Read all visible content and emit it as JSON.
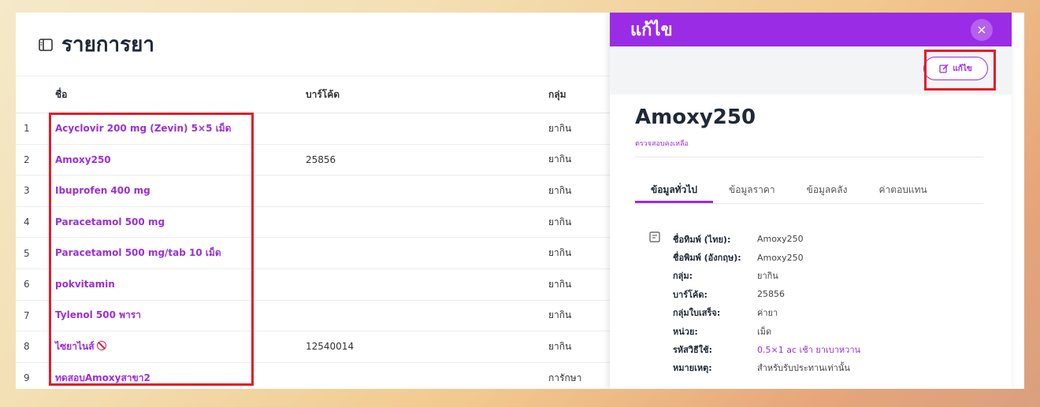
{
  "list": {
    "title": "รายการยา",
    "columns": {
      "name": "ชื่อ",
      "barcode": "บาร์โค้ด",
      "group": "กลุ่ม"
    },
    "rows": [
      {
        "no": "1",
        "name": "Acyclovir 200 mg (Zevin) 5×5 เม็ด",
        "barcode": "",
        "group": "ยากิน"
      },
      {
        "no": "2",
        "name": "Amoxy250",
        "barcode": "25856",
        "group": "ยากิน"
      },
      {
        "no": "3",
        "name": "Ibuprofen 400 mg",
        "barcode": "",
        "group": "ยากิน"
      },
      {
        "no": "4",
        "name": "Paracetamol 500 mg",
        "barcode": "",
        "group": "ยากิน"
      },
      {
        "no": "5",
        "name": "Paracetamol 500 mg/tab 10 เม็ด",
        "barcode": "",
        "group": "ยากิน"
      },
      {
        "no": "6",
        "name": "pokvitamin",
        "barcode": "",
        "group": "ยากิน"
      },
      {
        "no": "7",
        "name": "Tylenol 500 พารา",
        "barcode": "",
        "group": "ยากิน"
      },
      {
        "no": "8",
        "name": "ไซยาไนส์",
        "barcode": "12540014",
        "group": "ยากิน"
      },
      {
        "no": "9",
        "name": "ทดสอบAmoxyสาขา2",
        "barcode": "",
        "group": "การักษา"
      }
    ]
  },
  "drawer": {
    "title": "แก้ไข",
    "close_label": "×",
    "edit_label": "แก้ไข",
    "drug_name": "Amoxy250",
    "stock_link": "ตรวจสอบคงเหลือ",
    "tabs": [
      "ข้อมูลทั่วไป",
      "ข้อมูลราคา",
      "ข้อมูลคลัง",
      "ค่าตอบแทน"
    ],
    "details": [
      {
        "label": "ชื่อทิมพ์ (ไทย):",
        "value": "Amoxy250"
      },
      {
        "label": "ชื่อพิมพ์ (อังกฤษ):",
        "value": "Amoxy250"
      },
      {
        "label": "กลุ่ม:",
        "value": "ยากิน"
      },
      {
        "label": "บาร์โค้ด:",
        "value": "25856"
      },
      {
        "label": "กลุ่มใบเสร็จ:",
        "value": "ค่ายา"
      },
      {
        "label": "หน่วย:",
        "value": "เม็ด"
      },
      {
        "label": "รหัสวิธีใช้:",
        "value": "0.5×1 ac เช้า ยาเบาหวาน"
      },
      {
        "label": "หมายเหตุ:",
        "value": "สำหรับรับประทานเท่านั้น"
      }
    ]
  },
  "colors": {
    "accent": "#9b2ce6",
    "highlight": "#e21d2a"
  }
}
